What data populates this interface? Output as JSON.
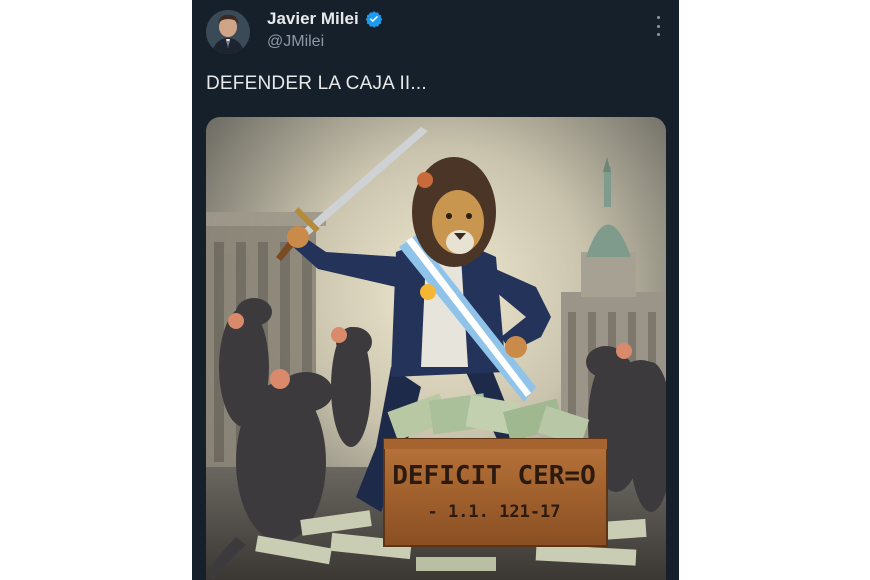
{
  "tweet": {
    "author": {
      "display_name": "Javier Milei",
      "handle": "@JMilei",
      "verified_icon": "verified-badge-icon",
      "avatar_icon": "avatar"
    },
    "text": "DEFENDER LA CAJA II...",
    "more_icon": "more-options-icon"
  },
  "image": {
    "box_label_line1": "DEFICIT CER=O",
    "box_label_line2": "- 1.1. 121-17"
  },
  "colors": {
    "tweet_bg": "#15202b",
    "text_primary": "#e7e9ea",
    "text_secondary": "#8b98a5",
    "verified_blue": "#1d9bf0"
  }
}
